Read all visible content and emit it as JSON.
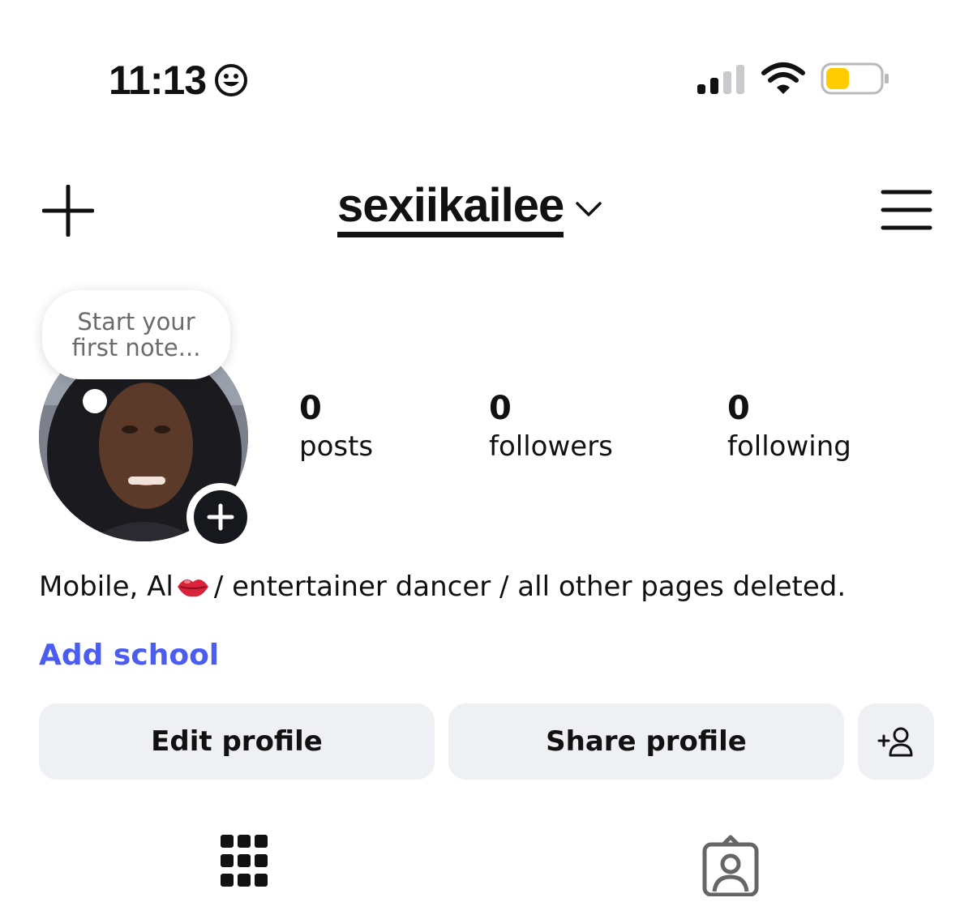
{
  "status_bar": {
    "time": "11:13",
    "time_icon": "smiley-face-icon",
    "signal_icon": "cellular-signal-icon",
    "wifi_icon": "wifi-icon",
    "battery_icon": "battery-icon",
    "battery_color": "#FFCC00"
  },
  "header": {
    "create_icon": "plus-icon",
    "username": "sexiikailee",
    "username_icon": "chevron-down-icon",
    "menu_icon": "hamburger-menu-icon"
  },
  "note": {
    "line1": "Start your",
    "line2": "first note..."
  },
  "profile": {
    "avatar_icon": "profile-photo",
    "add_story_icon": "plus-icon"
  },
  "stats": {
    "posts_count": "0",
    "posts_label": "posts",
    "followers_count": "0",
    "followers_label": "followers",
    "following_count": "0",
    "following_label": "following"
  },
  "bio": {
    "part1": "Mobile, Al",
    "emoji_icon": "kiss-lips-emoji",
    "part2": "/ entertainer dancer / all other pages deleted."
  },
  "add_school": {
    "label": "Add school",
    "color": "#4A5DF0"
  },
  "buttons": {
    "edit_profile": "Edit profile",
    "share_profile": "Share profile",
    "add_user_icon": "add-person-icon"
  },
  "tabs": {
    "grid_icon": "grid-icon",
    "tagged_icon": "tagged-person-icon"
  }
}
